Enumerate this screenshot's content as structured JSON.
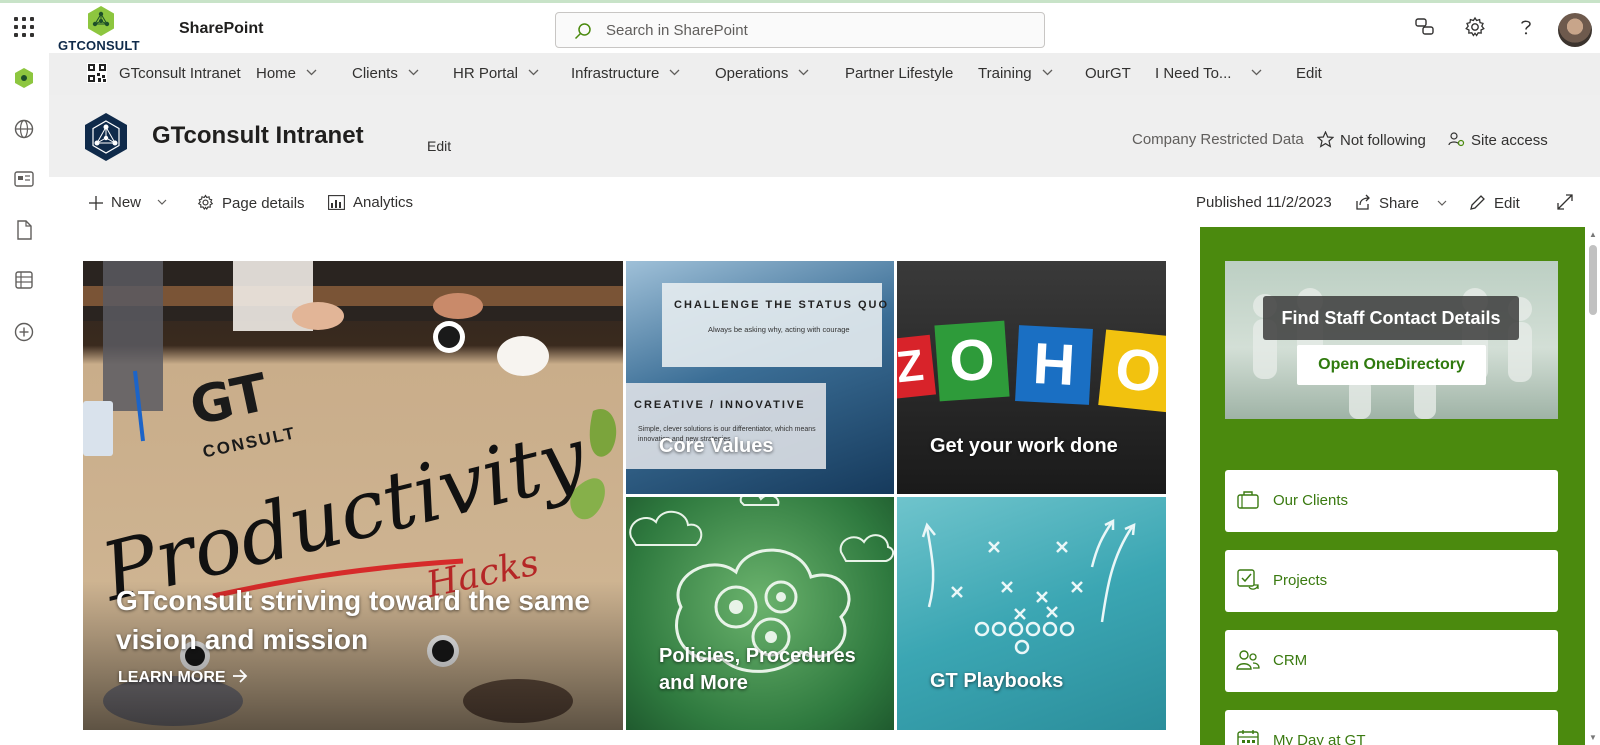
{
  "suite": {
    "logo_text": "GTCONSULT",
    "app_name": "SharePoint",
    "search_placeholder": "Search in SharePoint"
  },
  "hubnav": {
    "items": [
      {
        "label": "GTconsult Intranet",
        "dropdown": false
      },
      {
        "label": "Home",
        "dropdown": true
      },
      {
        "label": "Clients",
        "dropdown": true
      },
      {
        "label": "HR Portal",
        "dropdown": true
      },
      {
        "label": "Infrastructure",
        "dropdown": true
      },
      {
        "label": "Operations",
        "dropdown": true
      },
      {
        "label": "Partner Lifestyle",
        "dropdown": false
      },
      {
        "label": "Training",
        "dropdown": true
      },
      {
        "label": "OurGT",
        "dropdown": false
      },
      {
        "label": "I Need To...",
        "dropdown": true
      },
      {
        "label": "Edit",
        "dropdown": false
      }
    ]
  },
  "site": {
    "title": "GTconsult Intranet",
    "edit_label": "Edit",
    "classification": "Company Restricted Data",
    "follow_label": "Not following",
    "access_label": "Site access"
  },
  "commandbar": {
    "new_label": "New",
    "page_details_label": "Page details",
    "analytics_label": "Analytics",
    "published_label": "Published 11/2/2023",
    "share_label": "Share",
    "edit_label": "Edit"
  },
  "hero": {
    "main": {
      "title": "GTconsult striving toward the same vision and mission",
      "link_label": "LEARN MORE",
      "image_word": "Productivity",
      "image_sub": "Hacks",
      "image_logo_line1": "GT",
      "image_logo_line2": "CONSULT"
    },
    "tiles": [
      {
        "title": "Core Values",
        "card1_heading": "CHALLENGE THE STATUS QUO",
        "card1_text": "Always be asking why, acting with courage",
        "card2_heading": "CREATIVE / INNOVATIVE",
        "card2_text": "Simple, clever solutions is our differentiator, which means innovation and new strategies"
      },
      {
        "title": "Get your work done",
        "brand_letters": [
          "Z",
          "O",
          "H",
          "O"
        ]
      },
      {
        "title": "Policies, Procedures and More"
      },
      {
        "title": "GT Playbooks"
      }
    ]
  },
  "panel": {
    "staff_title": "Find Staff Contact Details",
    "staff_button": "Open OneDirectory",
    "links": [
      {
        "label": "Our Clients",
        "icon": "briefcase-icon"
      },
      {
        "label": "Projects",
        "icon": "task-sync-icon"
      },
      {
        "label": "CRM",
        "icon": "people-icon"
      },
      {
        "label": "My Day at GT",
        "icon": "calendar-icon"
      }
    ]
  },
  "colors": {
    "panel_green": "#4b8a0e",
    "link_green": "#3a7a10",
    "brand_navy": "#0f2a4a",
    "brand_lime": "#8dc63f"
  }
}
